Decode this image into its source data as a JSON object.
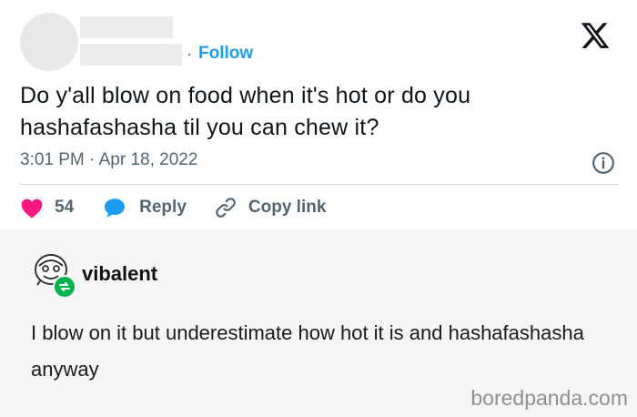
{
  "tweet": {
    "follow_label": "Follow",
    "separator": "·",
    "text": "Do y'all blow on food when it's hot or do you hashafashasha til you can chew it?",
    "timestamp": "3:01 PM · Apr 18, 2022",
    "likes": "54",
    "reply_label": "Reply",
    "copy_link_label": "Copy link"
  },
  "reply_post": {
    "username": "vibalent",
    "text": "I blow on it but underestimate how hot it is and hashafashasha anyway"
  },
  "watermark": "boredpanda.com",
  "colors": {
    "accent": "#1d9bf0",
    "like": "#f91880",
    "muted": "#536471",
    "reblog": "#00b34d"
  },
  "icons": [
    "x-logo-icon",
    "info-icon",
    "heart-icon",
    "reply-bubble-icon",
    "link-icon",
    "reblog-icon"
  ]
}
